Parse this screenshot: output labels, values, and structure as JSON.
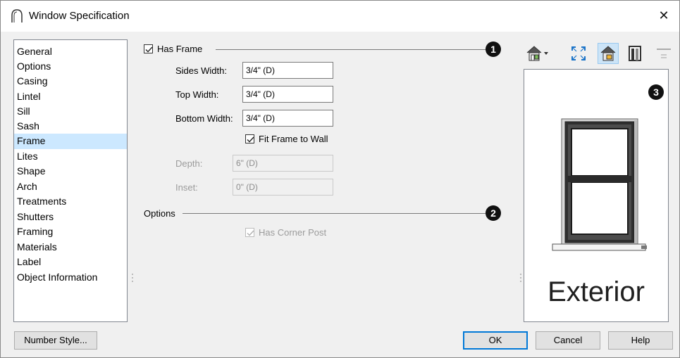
{
  "window": {
    "title": "Window Specification",
    "close_glyph": "✕"
  },
  "sidebar": {
    "items": [
      {
        "label": "General"
      },
      {
        "label": "Options"
      },
      {
        "label": "Casing"
      },
      {
        "label": "Lintel"
      },
      {
        "label": "Sill"
      },
      {
        "label": "Sash"
      },
      {
        "label": "Frame",
        "selected": true
      },
      {
        "label": "Lites"
      },
      {
        "label": "Shape"
      },
      {
        "label": "Arch"
      },
      {
        "label": "Treatments"
      },
      {
        "label": "Shutters"
      },
      {
        "label": "Framing"
      },
      {
        "label": "Materials"
      },
      {
        "label": "Label"
      },
      {
        "label": "Object Information"
      }
    ]
  },
  "frame": {
    "has_frame_label": "Has Frame",
    "has_frame_checked": true,
    "sides_width_label": "Sides Width:",
    "sides_width_value": "3/4\" (D)",
    "top_width_label": "Top Width:",
    "top_width_value": "3/4\" (D)",
    "bottom_width_label": "Bottom Width:",
    "bottom_width_value": "3/4\" (D)",
    "fit_frame_label": "Fit Frame to Wall",
    "fit_frame_checked": true,
    "depth_label": "Depth:",
    "depth_value": "6\" (D)",
    "inset_label": "Inset:",
    "inset_value": "0\" (D)"
  },
  "options": {
    "section_label": "Options",
    "corner_post_label": "Has Corner Post",
    "corner_post_checked": true,
    "corner_post_enabled": false
  },
  "callouts": {
    "c1": "1",
    "c2": "2",
    "c3": "3"
  },
  "toolbar": {
    "icons": [
      "view-type-icon",
      "fill-window-icon",
      "colors-icon",
      "frame-view-icon",
      "toggle-icon"
    ]
  },
  "preview": {
    "label": "Exterior"
  },
  "buttons": {
    "number_style": "Number Style...",
    "ok": "OK",
    "cancel": "Cancel",
    "help": "Help"
  },
  "colors": {
    "selected_bg": "#cce8ff",
    "accent": "#0078d7"
  }
}
